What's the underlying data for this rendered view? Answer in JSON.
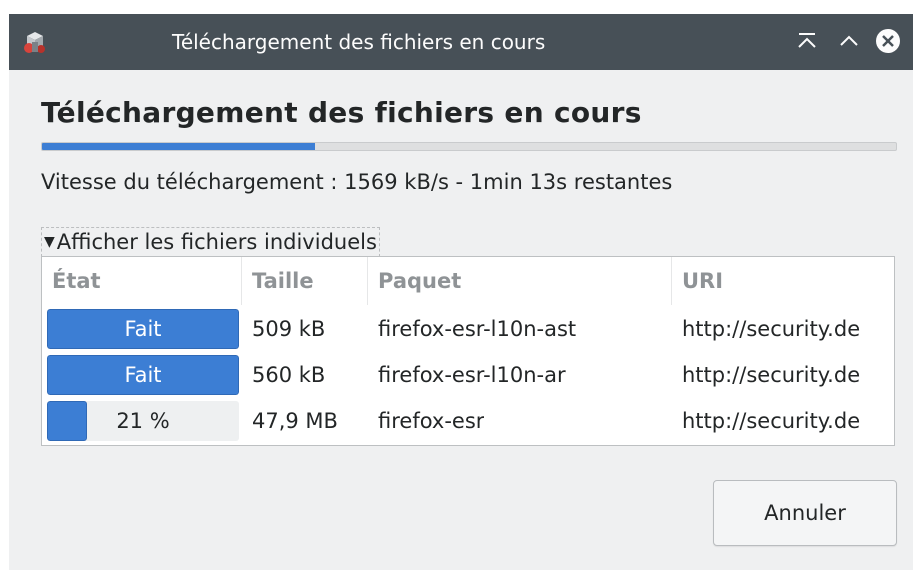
{
  "window": {
    "title": "Téléchargement des fichiers en cours"
  },
  "heading": "Téléchargement des fichiers en cours",
  "overall_progress": 0.32,
  "speed_text": "Vitesse du téléchargement : 1569 kB/s - 1min 13s restantes",
  "expander": {
    "label": "Afficher les fichiers individuels",
    "expanded": true
  },
  "table": {
    "columns": [
      "État",
      "Taille",
      "Paquet",
      "URI"
    ],
    "rows": [
      {
        "status": "Fait",
        "progress": 1.0,
        "size": "509 kB",
        "package": "firefox-esr-l10n-ast",
        "uri": "http://security.de"
      },
      {
        "status": "Fait",
        "progress": 1.0,
        "size": "560 kB",
        "package": "firefox-esr-l10n-ar",
        "uri": "http://security.de"
      },
      {
        "status": "21 %",
        "progress": 0.21,
        "size": "47,9 MB",
        "package": "firefox-esr",
        "uri": "http://security.de"
      }
    ]
  },
  "buttons": {
    "cancel": "Annuler"
  },
  "colors": {
    "titlebar": "#475057",
    "accent": "#3c7ed4",
    "background": "#eff0f1"
  },
  "icons": {
    "app": "package-manager-icon",
    "keep_above": "keep-above-icon",
    "maximize": "maximize-icon",
    "close": "close-icon",
    "expander": "triangle-down-icon"
  }
}
